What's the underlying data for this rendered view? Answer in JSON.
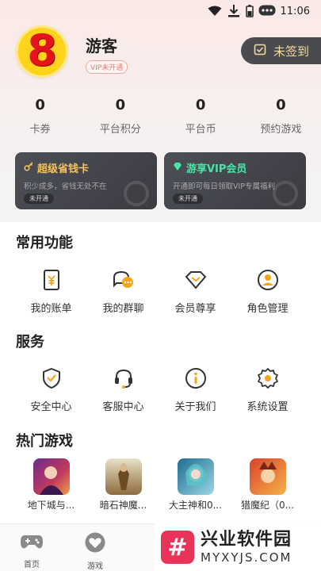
{
  "status_bar": {
    "time": "11:06"
  },
  "profile": {
    "avatar_text": "8",
    "username": "游客",
    "vip_status": "VIP未开通",
    "signin_label": "未签到"
  },
  "stats": [
    {
      "value": "0",
      "label": "卡券"
    },
    {
      "value": "0",
      "label": "平台积分"
    },
    {
      "value": "0",
      "label": "平台币"
    },
    {
      "value": "0",
      "label": "预约游戏"
    }
  ],
  "cards": {
    "saver": {
      "title": "超级省钱卡",
      "subtitle": "积少成多，省钱无处不在",
      "tag": "未开通",
      "title_color": "#f6c35b"
    },
    "vip": {
      "title": "游享VIP会员",
      "subtitle": "开通即可每日领取VIP专属福利",
      "tag": "未开通",
      "title_color": "#48e6a7"
    }
  },
  "common_functions": {
    "title": "常用功能",
    "items": [
      {
        "label": "我的账单",
        "icon": "bill-icon"
      },
      {
        "label": "我的群聊",
        "icon": "group-chat-icon"
      },
      {
        "label": "会员尊享",
        "icon": "diamond-icon"
      },
      {
        "label": "角色管理",
        "icon": "user-icon"
      }
    ]
  },
  "services": {
    "title": "服务",
    "items": [
      {
        "label": "安全中心",
        "icon": "shield-icon"
      },
      {
        "label": "客服中心",
        "icon": "headset-icon"
      },
      {
        "label": "关于我们",
        "icon": "info-icon"
      },
      {
        "label": "系统设置",
        "icon": "gear-icon"
      }
    ]
  },
  "hot_games": {
    "title": "热门游戏",
    "items": [
      {
        "name": "地下城与..."
      },
      {
        "name": "暗石神魔..."
      },
      {
        "name": "大主神和0..."
      },
      {
        "name": "猎魔纪（0..."
      }
    ]
  },
  "bottom_nav": [
    {
      "label": "首页",
      "icon": "gamepad-icon"
    },
    {
      "label": "游戏",
      "icon": "heart-icon"
    }
  ],
  "watermark": {
    "title": "兴业软件园",
    "url": "MYXYJS.COM"
  },
  "colors": {
    "accent": "#f5a318",
    "dark_card": "#45464b",
    "gold_text": "#f3d9a2"
  }
}
